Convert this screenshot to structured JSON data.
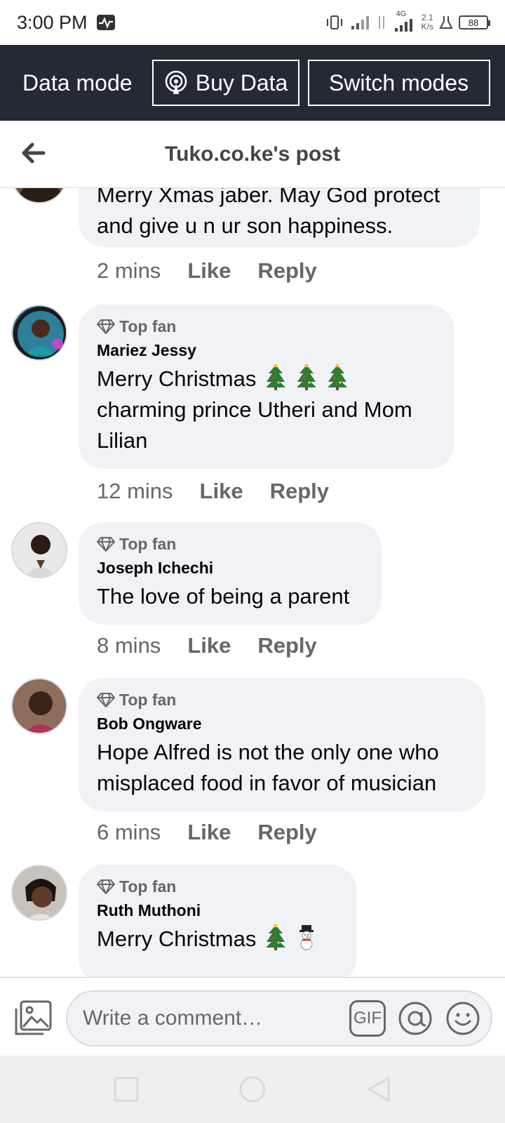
{
  "status_bar": {
    "time": "3:00 PM",
    "network": "4G",
    "speed_value": "2.1",
    "speed_unit": "K/s",
    "battery": "88"
  },
  "data_bar": {
    "label": "Data mode",
    "buy_label": "Buy Data",
    "switch_label": "Switch modes"
  },
  "header": {
    "title": "Tuko.co.ke's post"
  },
  "comments": [
    {
      "text": "Merry Xmas jaber. May God protect and give u n ur son happiness.",
      "time": "2 mins",
      "like": "Like",
      "reply": "Reply"
    },
    {
      "badge": "Top fan",
      "author": "Mariez Jessy",
      "text": "Merry Christmas",
      "text2": "charming prince Utheri and Mom Lilian",
      "time": "12 mins",
      "like": "Like",
      "reply": "Reply"
    },
    {
      "badge": "Top fan",
      "author": "Joseph Ichechi",
      "text": "The love of being a parent",
      "time": "8 mins",
      "like": "Like",
      "reply": "Reply"
    },
    {
      "badge": "Top fan",
      "author": "Bob Ongware",
      "text": "Hope Alfred is not the only one who misplaced food in favor of musician",
      "time": "6 mins",
      "like": "Like",
      "reply": "Reply"
    },
    {
      "badge": "Top fan",
      "author": "Ruth Muthoni",
      "text": "Merry Christmas"
    }
  ],
  "compose": {
    "placeholder": "Write a comment…",
    "gif_label": "GIF"
  },
  "colors": {
    "data_bar_bg": "#242a34",
    "bubble_bg": "#f0f2f5",
    "meta_text": "#65676b"
  }
}
